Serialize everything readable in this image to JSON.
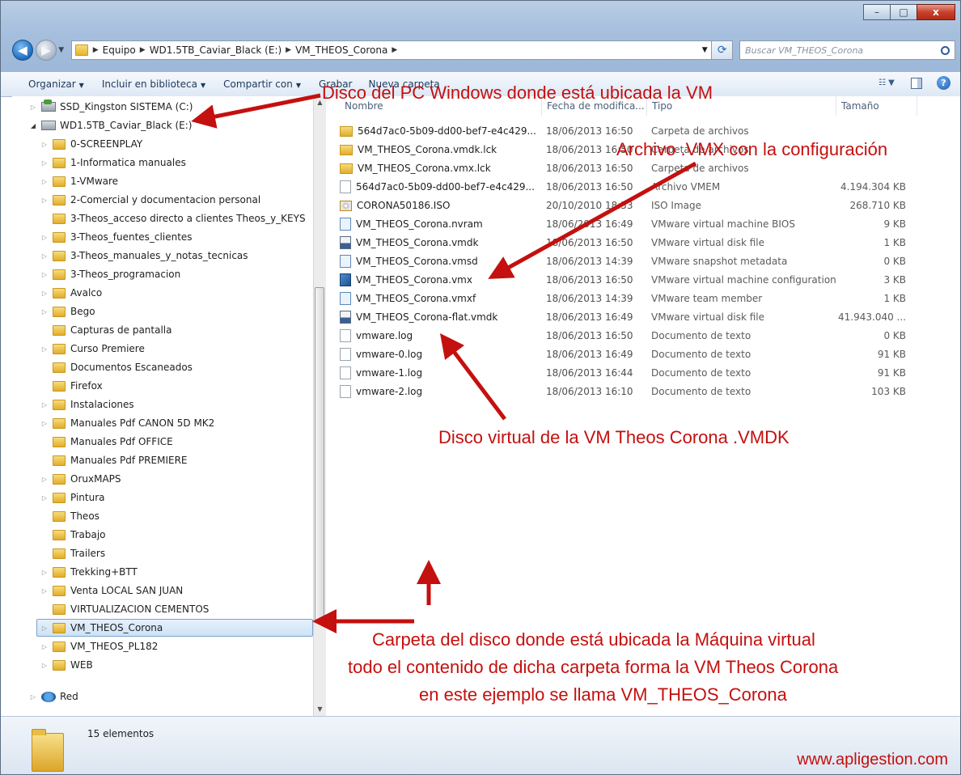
{
  "window": {
    "controls": {
      "minimize": "–",
      "maximize": "□",
      "close": "x"
    }
  },
  "address": {
    "crumbs": [
      "Equipo",
      "WD1.5TB_Caviar_Black (E:)",
      "VM_THEOS_Corona"
    ],
    "search_placeholder": "Buscar VM_THEOS_Corona"
  },
  "toolbar": {
    "organize": "Organizar",
    "include": "Incluir en biblioteca",
    "share": "Compartir con",
    "burn": "Grabar",
    "new_folder": "Nueva carpeta"
  },
  "tree": [
    {
      "label": "SSD_Kingston SISTEMA (C:)",
      "level": 0,
      "kind": "drive-ssd",
      "expander": "closed"
    },
    {
      "label": "WD1.5TB_Caviar_Black (E:)",
      "level": 0,
      "kind": "drive",
      "expander": "open"
    },
    {
      "label": "0-SCREENPLAY",
      "level": 1,
      "kind": "folder",
      "expander": "closed"
    },
    {
      "label": "1-Informatica manuales",
      "level": 1,
      "kind": "folder",
      "expander": "closed"
    },
    {
      "label": "1-VMware",
      "level": 1,
      "kind": "folder",
      "expander": "closed"
    },
    {
      "label": "2-Comercial y documentacion personal",
      "level": 1,
      "kind": "folder",
      "expander": "closed"
    },
    {
      "label": "3-Theos_acceso directo a clientes Theos_y_KEYS",
      "level": 1,
      "kind": "folder",
      "expander": "none"
    },
    {
      "label": "3-Theos_fuentes_clientes",
      "level": 1,
      "kind": "folder",
      "expander": "closed"
    },
    {
      "label": "3-Theos_manuales_y_notas_tecnicas",
      "level": 1,
      "kind": "folder",
      "expander": "closed"
    },
    {
      "label": "3-Theos_programacion",
      "level": 1,
      "kind": "folder",
      "expander": "closed"
    },
    {
      "label": "Avalco",
      "level": 1,
      "kind": "folder",
      "expander": "closed"
    },
    {
      "label": "Bego",
      "level": 1,
      "kind": "folder",
      "expander": "closed"
    },
    {
      "label": "Capturas de pantalla",
      "level": 1,
      "kind": "folder",
      "expander": "none"
    },
    {
      "label": "Curso Premiere",
      "level": 1,
      "kind": "folder",
      "expander": "closed"
    },
    {
      "label": "Documentos Escaneados",
      "level": 1,
      "kind": "folder",
      "expander": "none"
    },
    {
      "label": "Firefox",
      "level": 1,
      "kind": "folder",
      "expander": "none"
    },
    {
      "label": "Instalaciones",
      "level": 1,
      "kind": "folder",
      "expander": "closed"
    },
    {
      "label": "Manuales Pdf CANON 5D MK2",
      "level": 1,
      "kind": "folder",
      "expander": "closed"
    },
    {
      "label": "Manuales Pdf OFFICE",
      "level": 1,
      "kind": "folder",
      "expander": "none"
    },
    {
      "label": "Manuales Pdf PREMIERE",
      "level": 1,
      "kind": "folder",
      "expander": "none"
    },
    {
      "label": "OruxMAPS",
      "level": 1,
      "kind": "folder",
      "expander": "closed"
    },
    {
      "label": "Pintura",
      "level": 1,
      "kind": "folder",
      "expander": "closed"
    },
    {
      "label": "Theos",
      "level": 1,
      "kind": "folder",
      "expander": "none"
    },
    {
      "label": "Trabajo",
      "level": 1,
      "kind": "folder",
      "expander": "none"
    },
    {
      "label": "Trailers",
      "level": 1,
      "kind": "folder",
      "expander": "none"
    },
    {
      "label": "Trekking+BTT",
      "level": 1,
      "kind": "folder",
      "expander": "closed"
    },
    {
      "label": "Venta LOCAL SAN JUAN",
      "level": 1,
      "kind": "folder",
      "expander": "closed"
    },
    {
      "label": "VIRTUALIZACION CEMENTOS",
      "level": 1,
      "kind": "folder",
      "expander": "none"
    },
    {
      "label": "VM_THEOS_Corona",
      "level": 1,
      "kind": "folder",
      "expander": "closed",
      "selected": true
    },
    {
      "label": "VM_THEOS_PL182",
      "level": 1,
      "kind": "folder",
      "expander": "closed"
    },
    {
      "label": "WEB",
      "level": 1,
      "kind": "folder",
      "expander": "closed"
    },
    {
      "label": "Red",
      "level": 0,
      "kind": "network",
      "expander": "closed",
      "gap": true
    }
  ],
  "columns": {
    "name": "Nombre",
    "date": "Fecha de modifica...",
    "type": "Tipo",
    "size": "Tamaño"
  },
  "files": [
    {
      "name": "564d7ac0-5b09-dd00-bef7-e4c429...",
      "date": "18/06/2013 16:50",
      "type": "Carpeta de archivos",
      "size": "",
      "icon": "folder"
    },
    {
      "name": "VM_THEOS_Corona.vmdk.lck",
      "date": "18/06/2013 16:50",
      "type": "Carpeta de archivos",
      "size": "",
      "icon": "folder"
    },
    {
      "name": "VM_THEOS_Corona.vmx.lck",
      "date": "18/06/2013 16:50",
      "type": "Carpeta de archivos",
      "size": "",
      "icon": "folder"
    },
    {
      "name": "564d7ac0-5b09-dd00-bef7-e4c429...",
      "date": "18/06/2013 16:50",
      "type": "Archivo VMEM",
      "size": "4.194.304 KB",
      "icon": "blank"
    },
    {
      "name": "CORONA50186.ISO",
      "date": "20/10/2010 18:53",
      "type": "ISO Image",
      "size": "268.710 KB",
      "icon": "iso"
    },
    {
      "name": "VM_THEOS_Corona.nvram",
      "date": "18/06/2013 16:49",
      "type": "VMware virtual machine BIOS",
      "size": "9 KB",
      "icon": "bios"
    },
    {
      "name": "VM_THEOS_Corona.vmdk",
      "date": "18/06/2013 16:50",
      "type": "VMware virtual disk file",
      "size": "1 KB",
      "icon": "vmdk"
    },
    {
      "name": "VM_THEOS_Corona.vmsd",
      "date": "18/06/2013 14:39",
      "type": "VMware snapshot metadata",
      "size": "0 KB",
      "icon": "bios"
    },
    {
      "name": "VM_THEOS_Corona.vmx",
      "date": "18/06/2013 16:50",
      "type": "VMware virtual machine configuration",
      "size": "3 KB",
      "icon": "vmx"
    },
    {
      "name": "VM_THEOS_Corona.vmxf",
      "date": "18/06/2013 14:39",
      "type": "VMware team member",
      "size": "1 KB",
      "icon": "vmxf"
    },
    {
      "name": "VM_THEOS_Corona-flat.vmdk",
      "date": "18/06/2013 16:49",
      "type": "VMware virtual disk file",
      "size": "41.943.040 ...",
      "icon": "vmdk"
    },
    {
      "name": "vmware.log",
      "date": "18/06/2013 16:50",
      "type": "Documento de texto",
      "size": "0 KB",
      "icon": "log"
    },
    {
      "name": "vmware-0.log",
      "date": "18/06/2013 16:49",
      "type": "Documento de texto",
      "size": "91 KB",
      "icon": "log"
    },
    {
      "name": "vmware-1.log",
      "date": "18/06/2013 16:44",
      "type": "Documento de texto",
      "size": "91 KB",
      "icon": "log"
    },
    {
      "name": "vmware-2.log",
      "date": "18/06/2013 16:10",
      "type": "Documento de texto",
      "size": "103 KB",
      "icon": "log"
    }
  ],
  "status": {
    "count": "15 elementos"
  },
  "annotations": {
    "disk": "Disco del PC Windows donde está ubicada la VM",
    "vmx": "Archivo .VMX con la configuración",
    "vmdk": "Disco virtual de la VM Theos Corona .VMDK",
    "folder_1": "Carpeta del disco donde está ubicada la Máquina virtual",
    "folder_2": "todo el contenido de dicha carpeta forma la VM Theos Corona",
    "folder_3": "en este ejemplo se llama VM_THEOS_Corona",
    "color": "#c4100e"
  },
  "watermark": "www.apligestion.com"
}
